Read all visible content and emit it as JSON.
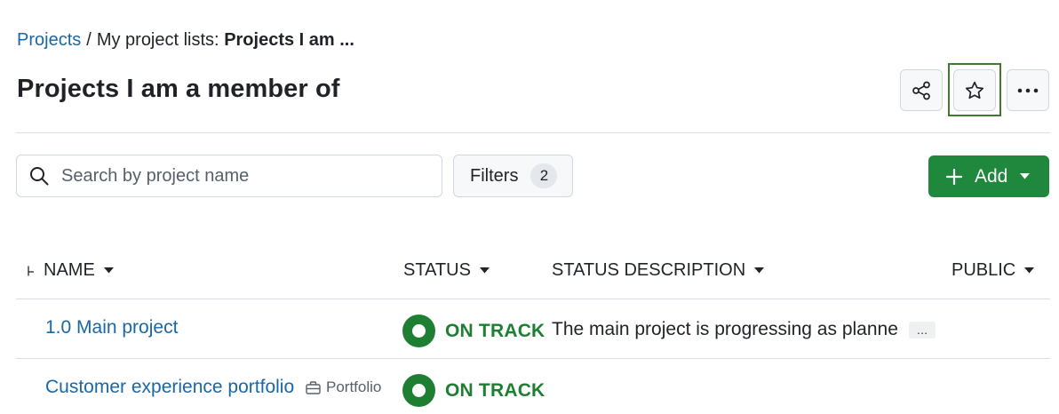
{
  "breadcrumb": {
    "root": "Projects",
    "separator": "/",
    "middle": "My project lists:",
    "current": "Projects I am ..."
  },
  "page_title": "Projects I am a member of",
  "toolbar": {
    "share_icon": "share-icon",
    "favorite_icon": "star-icon",
    "more_icon": "more-horizontal-icon",
    "more_label": "···"
  },
  "search": {
    "placeholder": "Search by project name",
    "value": ""
  },
  "filters": {
    "label": "Filters",
    "count": "2"
  },
  "add_button": {
    "label": "Add"
  },
  "table": {
    "columns": {
      "name": "NAME",
      "status": "STATUS",
      "status_description": "STATUS DESCRIPTION",
      "public": "PUBLIC"
    },
    "rows": [
      {
        "name": "1.0 Main project",
        "tag": "",
        "status": "ON TRACK",
        "status_description": "The main project is progressing as planned",
        "more": "…"
      },
      {
        "name": "Customer experience portfolio",
        "tag": "Portfolio",
        "status": "ON TRACK",
        "status_description": "",
        "more": ""
      }
    ]
  },
  "colors": {
    "link": "#1a67a3",
    "on_track": "#1e7f33",
    "primary_button": "#1f883d",
    "focus_outline": "#3f7a2e"
  }
}
